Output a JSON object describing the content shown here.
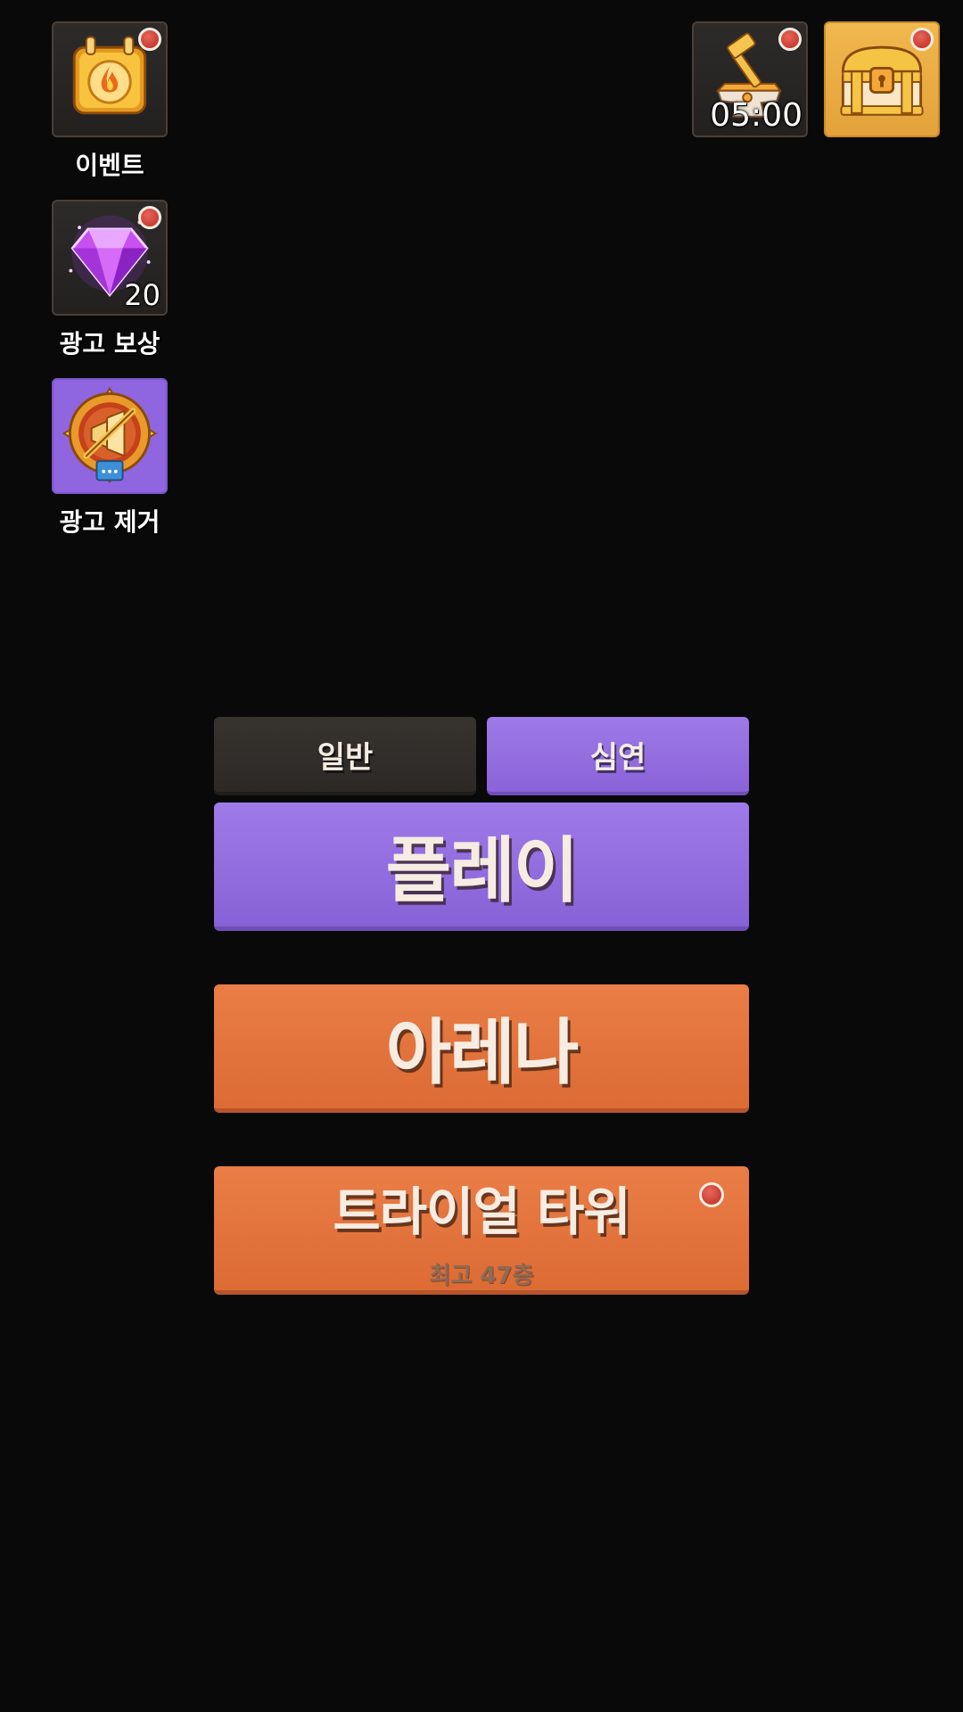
{
  "left_menu": {
    "event": {
      "label": "이벤트",
      "icon": "event-calendar-fire-icon",
      "has_notification": true
    },
    "ad_reward": {
      "label": "광고 보상",
      "icon": "purple-gem-icon",
      "count": "20",
      "has_notification": true
    },
    "remove_ads": {
      "label": "광고 제거",
      "icon": "no-ads-badge-icon",
      "has_notification": false
    }
  },
  "top_right": {
    "forge": {
      "icon": "anvil-hammer-icon",
      "timer": "05:00",
      "has_notification": true
    },
    "chest": {
      "icon": "treasure-chest-icon",
      "has_notification": true
    }
  },
  "mode_tabs": [
    {
      "label": "일반",
      "selected": false
    },
    {
      "label": "심연",
      "selected": true
    }
  ],
  "buttons": {
    "play": {
      "label": "플레이"
    },
    "arena": {
      "label": "아레나"
    },
    "trial_tower": {
      "label": "트라이얼 타워",
      "sub_label": "최고 47층",
      "has_notification": true
    }
  },
  "colors": {
    "background": "#090909",
    "purple_accent": "#8f66df",
    "orange_accent": "#e37439",
    "dark_tile": "#2a2826",
    "gold_tile": "#eaad45",
    "notification_red": "#d24a3e",
    "text_cream": "#f6ece2"
  }
}
